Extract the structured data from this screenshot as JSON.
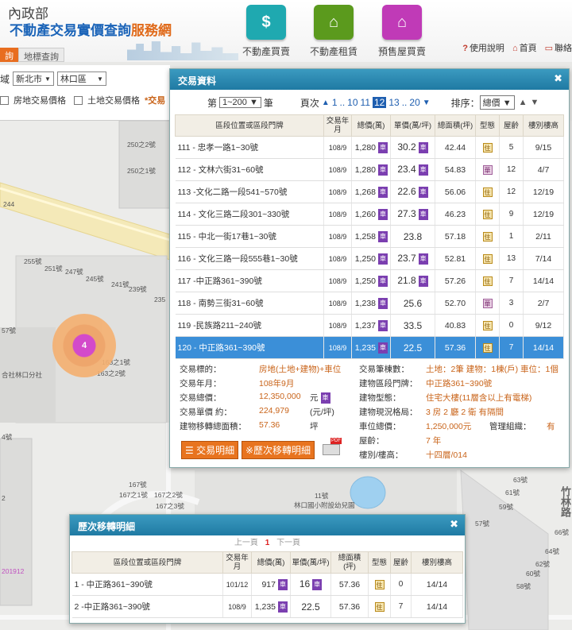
{
  "header": {
    "ministry": "內政部",
    "site_title": "不動產交易實價查詢",
    "site_title_highlight": "服務網",
    "nav": [
      {
        "label": "不動產買賣",
        "icon": "house-dollar-icon",
        "color": "#1fa9b0"
      },
      {
        "label": "不動產租賃",
        "icon": "house-rent-icon",
        "color": "#5b9a1d"
      },
      {
        "label": "預售屋買賣",
        "icon": "crane-house-icon",
        "color": "#c03ab7"
      }
    ],
    "links": [
      "使用說明",
      "首頁",
      "聯絡"
    ],
    "tabs": [
      "詢",
      "地標查詢"
    ]
  },
  "filter": {
    "prefix": "域",
    "city": "新北市",
    "district": "林口區",
    "opt_house": "房地交易價格",
    "opt_land": "土地交易價格",
    "opt_extra": "*交易",
    "city_arrow": "▼",
    "district_arrow": "▼"
  },
  "map": {
    "labels": [
      "250之2號",
      "250之1號",
      "244",
      "255號",
      "251號",
      "247號",
      "245號",
      "241號",
      "239號",
      "235",
      "57號",
      "合社林口分社",
      "163之1號",
      "163之2號",
      "167號",
      "167之1號",
      "167之2號",
      "167之3號",
      "11號",
      "林口國小附設幼兒園",
      "63號",
      "61號",
      "59號",
      "57號",
      "66號",
      "64號",
      "62號",
      "60號",
      "58號",
      "4號",
      "2",
      "201912",
      "竹林路"
    ],
    "cluster_count": "4"
  },
  "trade_panel": {
    "title": "交易資料",
    "close": "✖",
    "page_prefix": "第",
    "page_range": "1~200",
    "page_suffix": "筆",
    "pages_label": "頁次",
    "pages": [
      "1",
      "..",
      "10",
      "11",
      "12",
      "13",
      "..",
      "20"
    ],
    "current_page": "12",
    "sort_label": "排序：",
    "sort_value": "總價",
    "headers": [
      "區段位置或區段門牌",
      "交易年月",
      "總價(萬)",
      "單價(萬/坪)",
      "總面積(坪)",
      "型態",
      "屋齡",
      "樓別樓高"
    ],
    "rows": [
      {
        "addr": "111 - 忠孝一路1~30號",
        "ym": "108/9",
        "total": "1,280",
        "unit": "30.2",
        "unit_badge": true,
        "area": "42.44",
        "type": "住",
        "age": "5",
        "floor": "9/15"
      },
      {
        "addr": "112 - 文林六街31~60號",
        "ym": "108/9",
        "total": "1,280",
        "unit": "23.4",
        "unit_badge": true,
        "area": "54.83",
        "type": "華",
        "age": "12",
        "floor": "4/7"
      },
      {
        "addr": "113 -文化二路一段541~570號",
        "ym": "108/9",
        "total": "1,268",
        "unit": "22.6",
        "unit_badge": true,
        "area": "56.06",
        "type": "住",
        "age": "12",
        "floor": "12/19"
      },
      {
        "addr": "114 - 文化三路二段301~330號",
        "ym": "108/9",
        "total": "1,260",
        "unit": "27.3",
        "unit_badge": true,
        "area": "46.23",
        "type": "住",
        "age": "9",
        "floor": "12/19"
      },
      {
        "addr": "115 - 中北一街17巷1~30號",
        "ym": "108/9",
        "total": "1,258",
        "unit": "23.8",
        "unit_badge": false,
        "area": "57.18",
        "type": "住",
        "age": "1",
        "floor": "2/11"
      },
      {
        "addr": "116 - 文化三路一段555巷1~30號",
        "ym": "108/9",
        "total": "1,250",
        "unit": "23.7",
        "unit_badge": true,
        "area": "52.81",
        "type": "住",
        "age": "13",
        "floor": "7/14"
      },
      {
        "addr": "117 -中正路361~390號",
        "ym": "108/9",
        "total": "1,250",
        "unit": "21.8",
        "unit_badge": true,
        "area": "57.26",
        "type": "住",
        "age": "7",
        "floor": "14/14"
      },
      {
        "addr": "118 - 南勢三街31~60號",
        "ym": "108/9",
        "total": "1,238",
        "unit": "25.6",
        "unit_badge": false,
        "area": "52.70",
        "type": "華",
        "age": "3",
        "floor": "2/7"
      },
      {
        "addr": "119 -民族路211~240號",
        "ym": "108/9",
        "total": "1,237",
        "unit": "33.5",
        "unit_badge": false,
        "area": "40.83",
        "type": "住",
        "age": "0",
        "floor": "9/12"
      },
      {
        "addr": "120 - 中正路361~390號",
        "ym": "108/9",
        "total": "1,235",
        "unit": "22.5",
        "unit_badge": false,
        "area": "57.36",
        "type": "住",
        "age": "7",
        "floor": "14/14"
      }
    ],
    "badge": "車",
    "detail": {
      "k_target": "交易標的：",
      "v_target": "房地(土地+建物)+車位",
      "k_ym": "交易年月：",
      "v_ym": "108年9月",
      "k_total": "交易總價：",
      "v_total": "12,350,000",
      "u_total": "元",
      "k_unit": "交易單價 約：",
      "v_unit": "224,979",
      "u_unit": "(元/坪)",
      "k_area": "建物移轉總面積：",
      "v_area": "57.36",
      "u_area": "坪",
      "k_count": "交易筆棟數：",
      "v_count": "土地：2筆 建物：1棟(戶) 車位：1個",
      "k_addr": "建物區段門牌：",
      "v_addr": "中正路361~390號",
      "k_btype": "建物型態：",
      "v_btype": "住宅大樓(11層含以上有電梯)",
      "k_layout": "建物現況格局：",
      "v_layout": "3 房 2 廳 2 衛 有隔間",
      "k_park": "車位總價：",
      "v_park": "1,250,000元",
      "k_mgmt": "管理組織：",
      "v_mgmt": "有",
      "k_age": "屋齡：",
      "v_age": "7 年",
      "k_floor": "樓別/樓高：",
      "v_floor": "十四層/014",
      "btn_detail": "交易明細",
      "btn_history": "※歷次移轉明細",
      "pdf": "PDF"
    }
  },
  "history_panel": {
    "title": "歷次移轉明細",
    "close": "✖",
    "prev": "上一頁",
    "page": "1",
    "next": "下一頁",
    "headers": [
      "區段位置或區段門牌",
      "交易年月",
      "總價(萬)",
      "單價(萬/坪)",
      "總面積(坪)",
      "型態",
      "屋齡",
      "樓別樓高"
    ],
    "rows": [
      {
        "addr": "1 - 中正路361~390號",
        "ym": "101/12",
        "total": "917",
        "total_badge": true,
        "unit": "16",
        "unit_badge": true,
        "area": "57.36",
        "type": "住",
        "age": "0",
        "floor": "14/14"
      },
      {
        "addr": "2 -中正路361~390號",
        "ym": "108/9",
        "total": "1,235",
        "total_badge": true,
        "unit": "22.5",
        "unit_badge": false,
        "area": "57.36",
        "type": "住",
        "age": "7",
        "floor": "14/14"
      }
    ]
  }
}
